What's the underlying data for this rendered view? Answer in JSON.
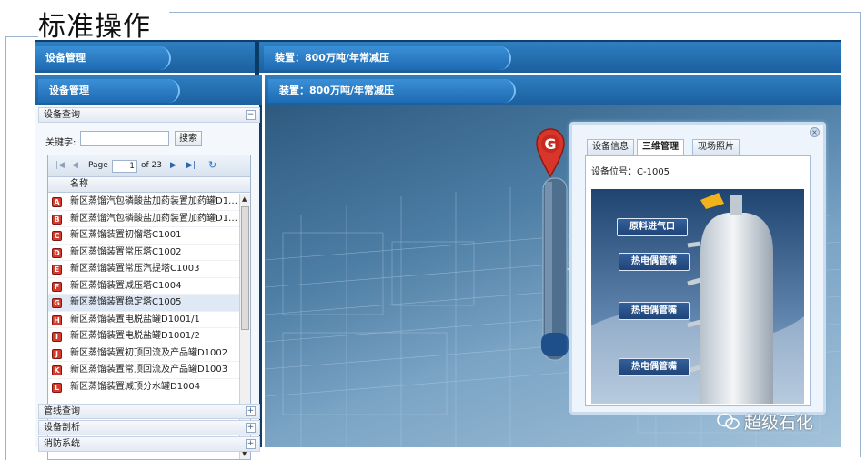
{
  "slide": {
    "title": "标准操作"
  },
  "top_bar": {
    "left_tab": "设备管理",
    "right_tab": "装置：800万吨/年常减压"
  },
  "left_panel": {
    "header_tab": "设备管理",
    "section_query": {
      "title": "设备查询",
      "toggle": "−"
    },
    "search": {
      "label": "关键字:",
      "value": "",
      "button": "搜索"
    },
    "pager": {
      "page_label": "Page",
      "page_value": "1",
      "of_label": "of 23"
    },
    "column_header": "名称",
    "rows": [
      {
        "badge": "A",
        "name": "新区蒸馏汽包磷酸盐加药装置加药罐D1…"
      },
      {
        "badge": "B",
        "name": "新区蒸馏汽包磷酸盐加药装置加药罐D1…"
      },
      {
        "badge": "C",
        "name": "新区蒸馏装置初馏塔C1001"
      },
      {
        "badge": "D",
        "name": "新区蒸馏装置常压塔C1002"
      },
      {
        "badge": "E",
        "name": "新区蒸馏装置常压汽提塔C1003"
      },
      {
        "badge": "F",
        "name": "新区蒸馏装置减压塔C1004"
      },
      {
        "badge": "G",
        "name": "新区蒸馏装置稳定塔C1005"
      },
      {
        "badge": "H",
        "name": "新区蒸馏装置电脱盐罐D1001/1"
      },
      {
        "badge": "I",
        "name": "新区蒸馏装置电脱盐罐D1001/2"
      },
      {
        "badge": "J",
        "name": "新区蒸馏装置初顶回流及产品罐D1002"
      },
      {
        "badge": "K",
        "name": "新区蒸馏装置常顶回流及产品罐D1003"
      },
      {
        "badge": "L",
        "name": "新区蒸馏装置减顶分水罐D1004"
      }
    ],
    "selected_index": 6,
    "section_pipeline": {
      "title": "管线查询",
      "toggle": "+"
    },
    "section_analysis": {
      "title": "设备剖析",
      "toggle": "+"
    },
    "section_fire": {
      "title": "消防系统",
      "toggle": "+"
    }
  },
  "main": {
    "header_tab": "装置：800万吨/年常减压",
    "marker_letter": "G"
  },
  "popup": {
    "tabs": [
      "设备信息",
      "三维管理",
      "现场照片"
    ],
    "active_tab": 1,
    "close": "×",
    "position_label": "设备位号：C-1005",
    "callouts": [
      "原料进气口",
      "热电偶管嘴",
      "热电偶管嘴",
      "热电偶管嘴"
    ]
  },
  "watermark": {
    "text": "超级石化"
  },
  "colors": {
    "header_blue": "#1b5f9f",
    "badge_red": "#d53a2c",
    "marker_red": "#d8362a",
    "callout_blue": "#2a528a"
  }
}
